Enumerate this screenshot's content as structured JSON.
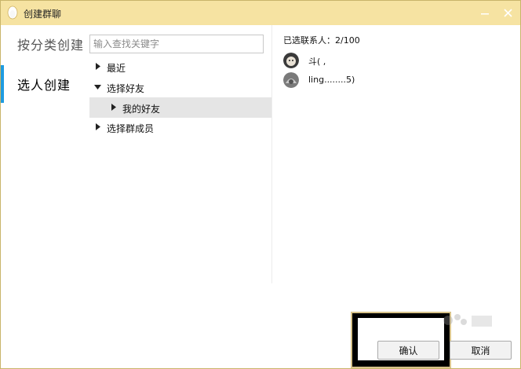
{
  "window": {
    "title": "创建群聊",
    "icons": {
      "app": "penguin-icon",
      "minimize": "minimize-icon",
      "close": "close-icon"
    }
  },
  "modes": [
    {
      "label": "按分类创建",
      "active": false
    },
    {
      "label": "选人创建",
      "active": true
    }
  ],
  "search": {
    "placeholder": "输入查找关键字",
    "value": ""
  },
  "tree": [
    {
      "label": "最近",
      "expanded": false,
      "level": 0
    },
    {
      "label": "选择好友",
      "expanded": true,
      "level": 0
    },
    {
      "label": "我的好友",
      "expanded": false,
      "level": 1,
      "selected": true
    },
    {
      "label": "选择群成员",
      "expanded": false,
      "level": 0
    }
  ],
  "selected": {
    "count_label": "已选联系人：2/100",
    "contacts": [
      {
        "name": "斗(                    ,"
      },
      {
        "name": "ling........5)"
      }
    ]
  },
  "footer": {
    "confirm_label": "确认",
    "cancel_label": "取消"
  },
  "colors": {
    "titlebar": "#f6e3a2",
    "accent": "#1e9be0",
    "selected_row": "#e5e5e5"
  }
}
